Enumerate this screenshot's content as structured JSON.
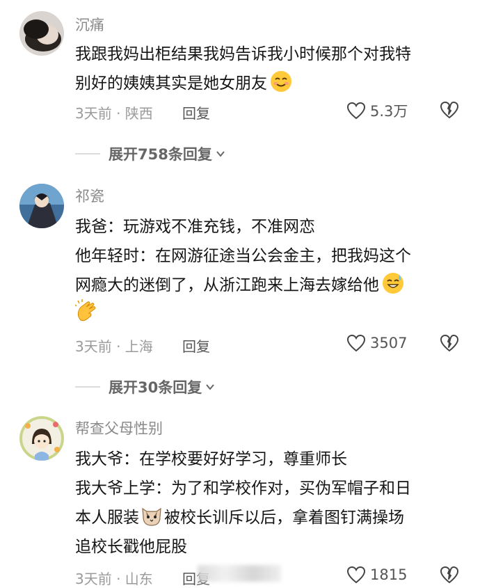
{
  "comments": [
    {
      "username": "沉痛",
      "lines": [
        "我跟我妈出柜结果我妈告诉我小时候那个对我特",
        "别好的姨姨其实是她女朋友"
      ],
      "time_location": "3天前 · 陕西",
      "reply_label": "回复",
      "likes": "5.3万",
      "emoji": "smiling-face-emoji",
      "expand_label": "展开758条回复"
    },
    {
      "username": "祁瓷",
      "lines": [
        "我爸：玩游戏不准充钱，不准网恋",
        "他年轻时：在网游征途当公会金主，把我妈这个",
        "网瘾大的迷倒了，从浙江跑来上海去嫁给他"
      ],
      "time_location": "3天前 · 上海",
      "reply_label": "回复",
      "likes": "3507",
      "emoji": "sweat-smile-emoji",
      "emoji2": "clapping-hands-emoji",
      "expand_label": "展开30条回复"
    },
    {
      "username": "帮查父母性别",
      "lines": [
        "我大爷：在学校要好好学习，尊重师长",
        "我大爷上学：为了和学校作对，买伪军帽子和日",
        "本人服装",
        "被校长训斥以后，拿着图钉满操场",
        "追校长戳他屁股"
      ],
      "time_location": "3天前 · 山东",
      "reply_label": "回复",
      "likes": "1815",
      "emoji": "cat-face-emoji"
    }
  ],
  "colors": {
    "text": "#161616",
    "muted": "#9a9a9a",
    "username": "#8a8a8a"
  }
}
